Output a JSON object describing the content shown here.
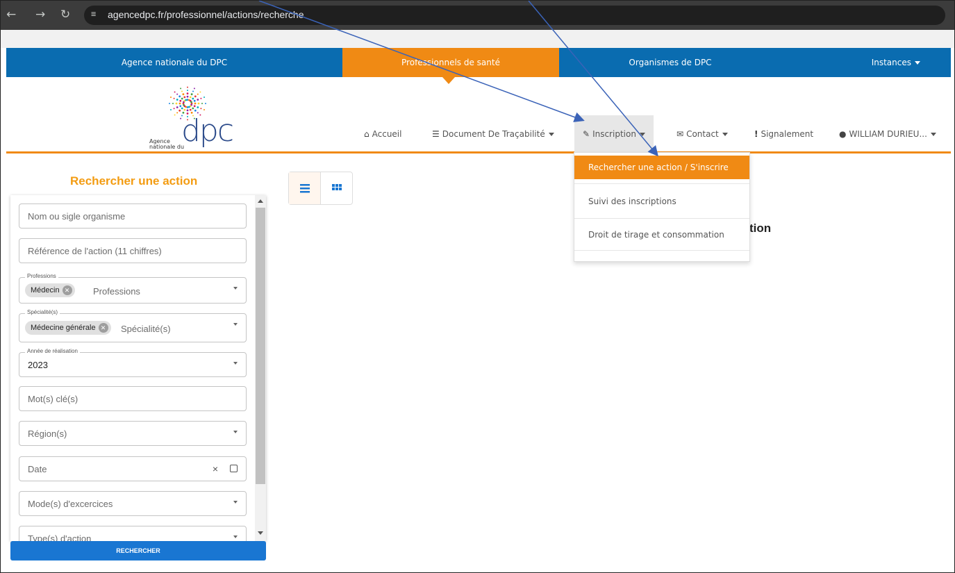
{
  "browser": {
    "url": "agencedpc.fr/professionnel/actions/recherche"
  },
  "topnav": {
    "items": [
      {
        "label": "Agence nationale du DPC"
      },
      {
        "label": "Professionnels de santé"
      },
      {
        "label": "Organismes de DPC"
      },
      {
        "label": "Instances"
      }
    ]
  },
  "logo": {
    "wordmark": "dpc",
    "line1": "Agence",
    "line2": "nationale du"
  },
  "mainnav": {
    "accueil": "Accueil",
    "document": "Document De Traçabilité",
    "inscription": "Inscription",
    "contact": "Contact",
    "signalement": "Signalement",
    "user": "WILLIAM DURIEU..."
  },
  "dropdown": {
    "items": [
      {
        "label": "Rechercher une action / S'inscrire"
      },
      {
        "label": "Suivi des inscriptions"
      },
      {
        "label": "Droit de tirage et consommation"
      }
    ]
  },
  "panel": {
    "title": "Rechercher une action",
    "organisme_placeholder": "Nom ou sigle organisme",
    "reference_placeholder": "Référence de l'action (11 chiffres)",
    "professions_legend": "Professions",
    "professions_chip": "Médecin",
    "professions_placeholder": "Professions",
    "specialite_legend": "Spécialité(s)",
    "specialite_chip": "Médecine générale",
    "specialite_placeholder": "Spécialité(s)",
    "annee_legend": "Année de réalisation",
    "annee_value": "2023",
    "motcle_placeholder": "Mot(s) clé(s)",
    "region_placeholder": "Région(s)",
    "date_placeholder": "Date",
    "mode_placeholder": "Mode(s) d'excercices",
    "type_placeholder": "Type(s) d'action",
    "search_button": "RECHERCHER"
  },
  "background_text": "tion",
  "colors": {
    "brand_blue": "#0a6cb0",
    "brand_orange": "#f08a14",
    "button_blue": "#1976d2",
    "title_orange": "#f39c12",
    "annotation_arrow": "#3b63b8"
  }
}
